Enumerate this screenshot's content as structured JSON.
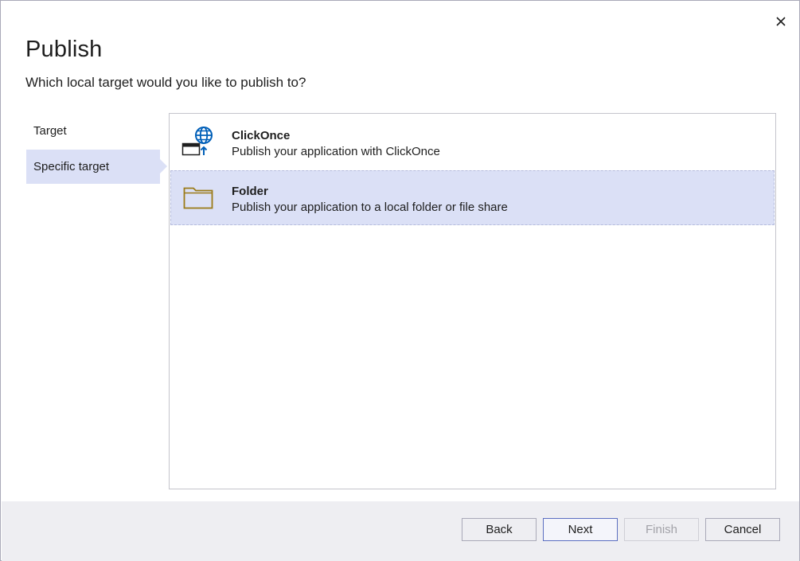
{
  "dialog": {
    "title": "Publish",
    "subtitle": "Which local target would you like to publish to?"
  },
  "steps": [
    {
      "label": "Target",
      "active": false
    },
    {
      "label": "Specific target",
      "active": true
    }
  ],
  "options": [
    {
      "name": "ClickOnce",
      "description": "Publish your application with ClickOnce",
      "icon": "clickonce-icon",
      "selected": false
    },
    {
      "name": "Folder",
      "description": "Publish your application to a local folder or file share",
      "icon": "folder-icon",
      "selected": true
    }
  ],
  "buttons": {
    "back": "Back",
    "next": "Next",
    "finish": "Finish",
    "cancel": "Cancel"
  },
  "colors": {
    "selection": "#dbe0f6",
    "accent": "#005fb8",
    "folder": "#9b7a17"
  }
}
